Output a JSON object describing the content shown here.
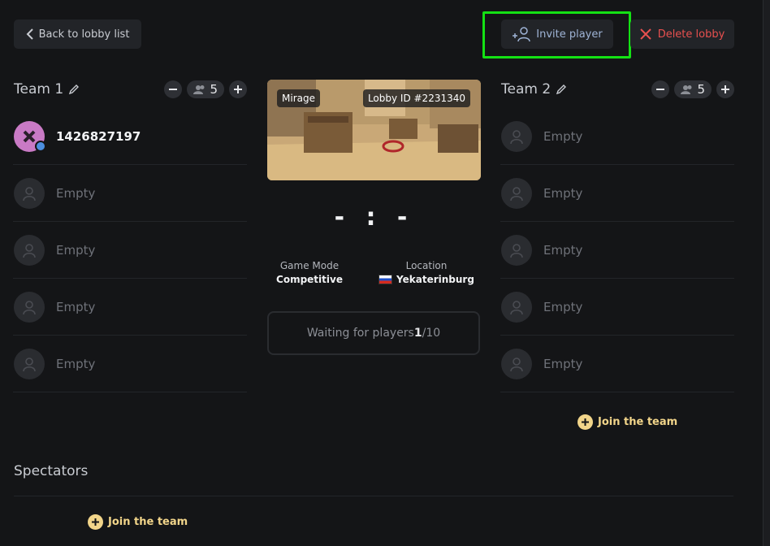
{
  "header": {
    "back_label": "Back to lobby list",
    "invite_label": "Invite player",
    "delete_label": "Delete lobby"
  },
  "team1": {
    "title": "Team 1",
    "count": "5",
    "slots": [
      {
        "name": "1426827197",
        "filled": true
      },
      {
        "name": "Empty"
      },
      {
        "name": "Empty"
      },
      {
        "name": "Empty"
      },
      {
        "name": "Empty"
      }
    ]
  },
  "team2": {
    "title": "Team 2",
    "count": "5",
    "slots": [
      {
        "name": "Empty"
      },
      {
        "name": "Empty"
      },
      {
        "name": "Empty"
      },
      {
        "name": "Empty"
      },
      {
        "name": "Empty"
      }
    ],
    "join_label": "Join the team"
  },
  "match": {
    "map_name": "Mirage",
    "lobby_id": "Lobby ID #2231340",
    "score": "- : -",
    "game_mode_label": "Game Mode",
    "game_mode_value": "Competitive",
    "location_label": "Location",
    "location_value": "Yekaterinburg",
    "waiting_prefix": "Waiting for players ",
    "waiting_current": "1",
    "waiting_total": "/10"
  },
  "spectators": {
    "title": "Spectators",
    "join_label": "Join the team"
  },
  "colors": {
    "background": "#141517",
    "accent_join": "#f2d58a",
    "delete": "#e8504f",
    "highlight": "#14e114"
  }
}
